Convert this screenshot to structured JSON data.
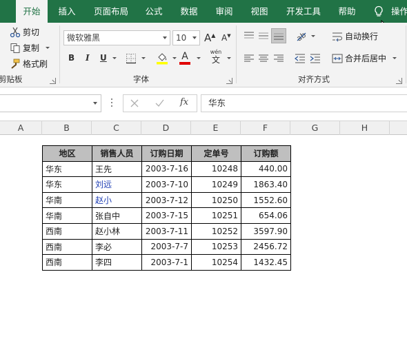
{
  "ribbon_tabs": [
    {
      "label": "开始"
    },
    {
      "label": "插入"
    },
    {
      "label": "页面布局"
    },
    {
      "label": "公式"
    },
    {
      "label": "数据"
    },
    {
      "label": "审阅"
    },
    {
      "label": "视图"
    },
    {
      "label": "开发工具"
    },
    {
      "label": "帮助"
    },
    {
      "label": "操作"
    }
  ],
  "clipboard": {
    "cut": "剪切",
    "copy": "复制",
    "format_painter": "格式刷",
    "group_label": "剪贴板"
  },
  "font": {
    "family": "微软雅黑",
    "size": "10",
    "group_label": "字体",
    "bold": "B",
    "italic": "I",
    "underline": "U",
    "font_color_label": "A",
    "phonetic_label": "wén"
  },
  "alignment": {
    "wrap_text": "自动换行",
    "merge_center": "合并后居中",
    "group_label": "对齐方式"
  },
  "formula_bar": {
    "fx_label": "fx",
    "content": "华东"
  },
  "columns": [
    "A",
    "B",
    "C",
    "D",
    "E",
    "F",
    "G",
    "H"
  ],
  "table": {
    "headers": [
      "地区",
      "销售人员",
      "订购日期",
      "定单号",
      "订购额"
    ],
    "rows": [
      [
        "华东",
        "王先",
        "2003-7-16",
        "10248",
        "440.00"
      ],
      [
        "华东",
        "刘远",
        "2003-7-10",
        "10249",
        "1863.40"
      ],
      [
        "华南",
        "赵小",
        "2003-7-12",
        "10250",
        "1552.60"
      ],
      [
        "华南",
        "张自中",
        "2003-7-15",
        "10251",
        "654.06"
      ],
      [
        "西南",
        "赵小林",
        "2003-7-11",
        "10252",
        "3597.90"
      ],
      [
        "西南",
        "李必",
        "2003-7-7",
        "10253",
        "2456.72"
      ],
      [
        "西南",
        "李四",
        "2003-7-1",
        "10254",
        "1432.45"
      ]
    ]
  },
  "colors": {
    "accent": "#217346",
    "header_fill": "#bfbfbf",
    "font_color_bar": "#e00000",
    "fill_color_bar": "#ffff00"
  }
}
